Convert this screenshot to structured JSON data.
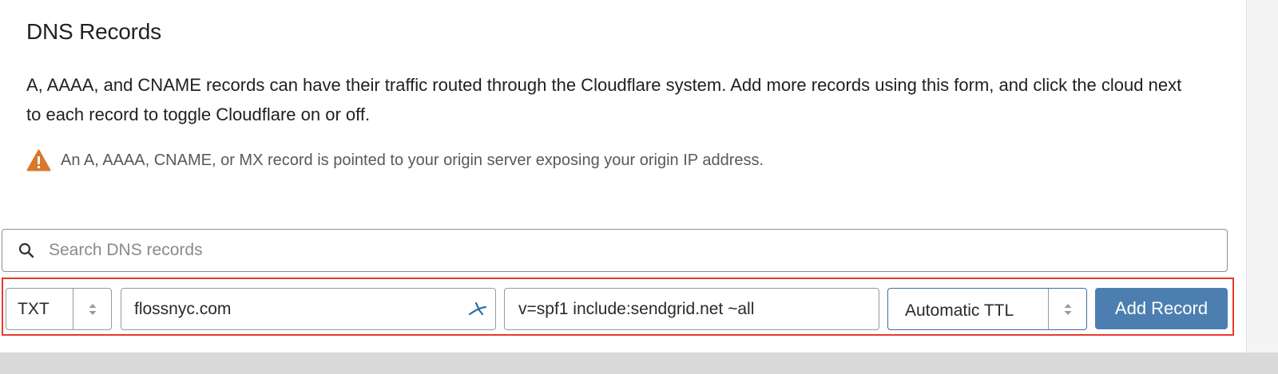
{
  "section": {
    "title": "DNS Records",
    "description": "A, AAAA, and CNAME records can have their traffic routed through the Cloudflare system. Add more records using this form, and click the cloud next to each record to toggle Cloudflare on or off.",
    "warning": "An A, AAAA, CNAME, or MX record is pointed to your origin server exposing your origin IP address."
  },
  "search": {
    "placeholder": "Search DNS records",
    "value": ""
  },
  "form": {
    "type": "TXT",
    "name": "flossnyc.com",
    "content": "v=spf1 include:sendgrid.net ~all",
    "ttl": "Automatic TTL",
    "add_label": "Add Record"
  },
  "colors": {
    "accent": "#4c7fb0",
    "warning": "#d9772b",
    "highlight": "#e53a2f"
  },
  "icons": {
    "warning": "warning-triangle-icon",
    "search": "search-icon",
    "stepper": "chevron-up-down-icon",
    "autofill": "autofill-icon"
  }
}
